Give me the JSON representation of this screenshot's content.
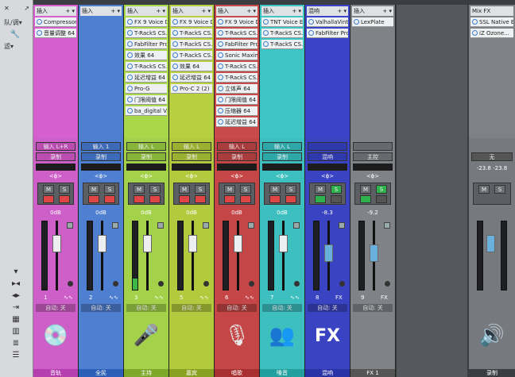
{
  "toolbar": {
    "close": "✕",
    "pin": "📌",
    "route_label": "队/调▾",
    "wrench": "🔧",
    "filter_label": "滤▾"
  },
  "channels": [
    {
      "color": "#d65fcf",
      "ins": "插入",
      "slots": [
        "Compressor",
        "音量调整 64"
      ],
      "input": "输入 L+R",
      "mode": "录制",
      "vol": "0dB",
      "num": "1",
      "auto": "自动: 关",
      "icon": "💿",
      "name": "音轨",
      "namecolor": "#b53fae",
      "tint": "#cf5fc8",
      "inbg": "#b94db0",
      "msm": "#6c7075"
    },
    {
      "color": "#4f7fd0",
      "ins": "插入",
      "slots": [],
      "input": "输入 1",
      "mode": "录制",
      "vol": "0dB",
      "num": "2",
      "auto": "自动: 关",
      "icon": "",
      "name": "全民",
      "namecolor": "#2e5fb8",
      "tint": "#4f7fd0",
      "inbg": "#3e6bb8",
      "msm": "#6c7075"
    },
    {
      "color": "#a8d84a",
      "ins": "插入",
      "slots": [
        "FX 9 Voice D...",
        "T-RackS CS...",
        "FabFilter Pro...",
        "效果 64",
        "T-RackS CS...",
        "延迟增益 64",
        "Pro-G",
        "门限阈值 64",
        "ba_digital V3..."
      ],
      "input": "输入 L",
      "mode": "录制",
      "vol": "0dB",
      "num": "3",
      "auto": "自动: 关",
      "icon": "🎤",
      "name": "主持",
      "namecolor": "#7ea82a",
      "tint": "#a3d24a",
      "inbg": "#86b53a",
      "msm": "#6c7075"
    },
    {
      "color": "#b8d040",
      "ins": "插入",
      "slots": [
        "FX 9 Voice D...",
        "T-RackS CS...",
        "T-RackS CS...",
        "T-RackS CS...",
        "效果 64",
        "延迟增益 64",
        "Pro-C 2 (2)"
      ],
      "input": "输入 L",
      "mode": "录制",
      "vol": "0dB",
      "num": "5",
      "auto": "自动: 关",
      "icon": "",
      "name": "嘉宾",
      "namecolor": "#8aa020",
      "tint": "#b3ca3e",
      "inbg": "#9ab030",
      "msm": "#6c7075"
    },
    {
      "color": "#c94a4a",
      "ins": "插入",
      "slots": [
        "FX 9 Voice D...",
        "T-RackS CS...",
        "FabFilter Pro...",
        "Sonic Maxim...",
        "T-RackS CS...",
        "T-RackS CS...",
        "立体声 64",
        "门限阈值 64",
        "压缩器 64",
        "延迟增益 64"
      ],
      "input": "输入 L",
      "mode": "录制",
      "vol": "0dB",
      "num": "6",
      "auto": "自动: 关",
      "icon": "🎙",
      "name": "唱歌",
      "namecolor": "#a83030",
      "tint": "#c54646",
      "inbg": "#a93c3c",
      "msm": "#6c7075"
    },
    {
      "color": "#3fc4c4",
      "ins": "插入",
      "slots": [
        "TNT Voice E...",
        "T-RackS CS...",
        "T-RackS CS..."
      ],
      "input": "输入 L",
      "mode": "录制",
      "vol": "0dB",
      "num": "7",
      "auto": "自动: 关",
      "icon": "👥",
      "name": "嗓音",
      "namecolor": "#22a0a0",
      "tint": "#3dbfc0",
      "inbg": "#2ea7a8",
      "msm": "#6c7075"
    },
    {
      "color": "#3b44c8",
      "ins": "混响",
      "slots": [
        "ValhallaVinta...",
        "FabFilter Pro..."
      ],
      "input": "",
      "mode": "混响",
      "vol": "-8.3",
      "num": "8",
      "auto": "自动: 关",
      "icon": "FX",
      "name": "混响",
      "namecolor": "#2a32a8",
      "tint": "#3a43c2",
      "inbg": "#2f38ad",
      "msm": "#6c7075"
    },
    {
      "color": "#7f8388",
      "ins": "插入",
      "slots": [
        "LexPlate"
      ],
      "input": "",
      "mode": "主控",
      "vol": "-9.2",
      "num": "9",
      "auto": "自动: 关",
      "icon": "",
      "name": "FX 1",
      "namecolor": "#555",
      "tint": "#7f8388",
      "inbg": "#666a6f",
      "msm": "#6c7075"
    }
  ],
  "master": {
    "ins": "Mix FX",
    "slots": [
      "SSL Native B...",
      "iZ Ozone..."
    ],
    "mode": "无",
    "lvl_l": "-23.8",
    "lvl_r": "-23.8",
    "icon": "🔊",
    "name": "录制"
  }
}
